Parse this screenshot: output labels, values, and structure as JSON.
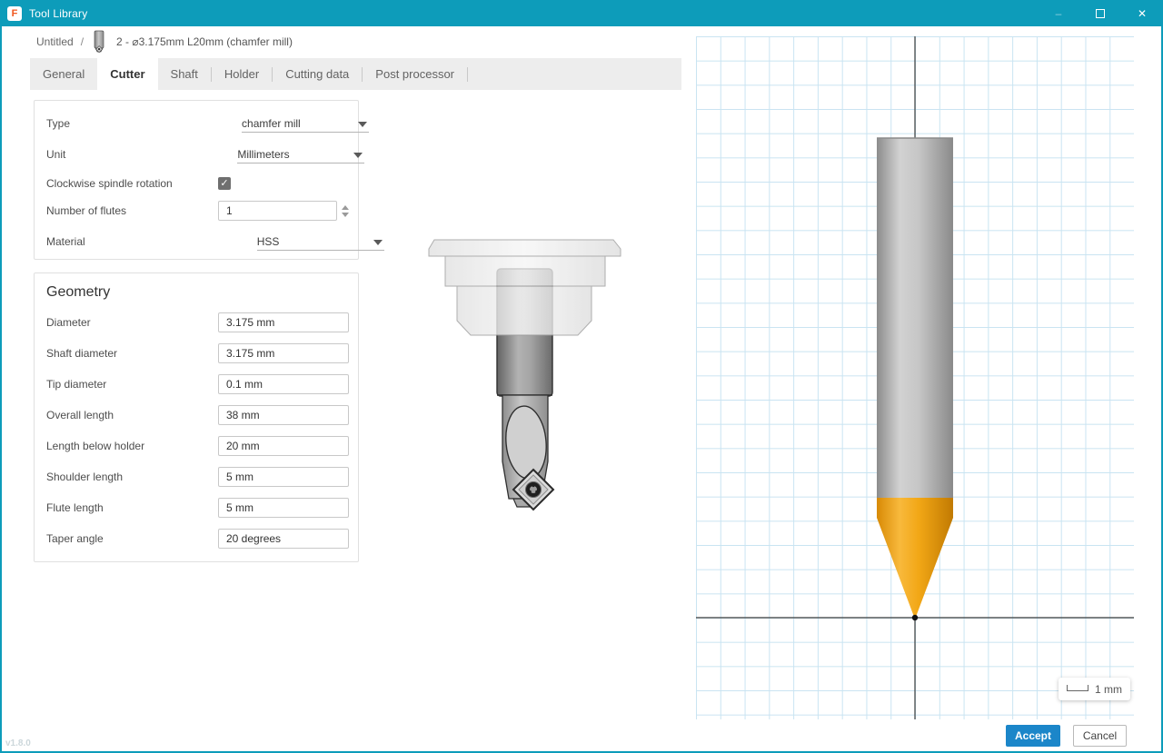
{
  "titlebar": {
    "title": "Tool Library",
    "controls": {
      "minimize": "–",
      "close": "✕"
    }
  },
  "breadcrumb": {
    "root": "Untitled",
    "separator": "/",
    "current": "2 - ⌀3.175mm L20mm (chamfer mill)"
  },
  "tabs": [
    {
      "label": "General",
      "active": false
    },
    {
      "label": "Cutter",
      "active": true
    },
    {
      "label": "Shaft",
      "active": false
    },
    {
      "label": "Holder",
      "active": false
    },
    {
      "label": "Cutting data",
      "active": false
    },
    {
      "label": "Post processor",
      "active": false
    }
  ],
  "cutter": {
    "type": {
      "label": "Type",
      "value": "chamfer mill"
    },
    "unit": {
      "label": "Unit",
      "value": "Millimeters"
    },
    "clockwise": {
      "label": "Clockwise spindle rotation",
      "checked": true
    },
    "flutes": {
      "label": "Number of flutes",
      "value": "1"
    },
    "material": {
      "label": "Material",
      "value": "HSS"
    }
  },
  "geometry": {
    "title": "Geometry",
    "fields": [
      {
        "label": "Diameter",
        "value": "3.175 mm"
      },
      {
        "label": "Shaft diameter",
        "value": "3.175 mm"
      },
      {
        "label": "Tip diameter",
        "value": "0.1 mm"
      },
      {
        "label": "Overall length",
        "value": "38 mm"
      },
      {
        "label": "Length below holder",
        "value": "20 mm"
      },
      {
        "label": "Shoulder length",
        "value": "5 mm"
      },
      {
        "label": "Flute length",
        "value": "5 mm"
      },
      {
        "label": "Taper angle",
        "value": "20 degrees"
      }
    ]
  },
  "viewport": {
    "scale_label": "1 mm"
  },
  "footer": {
    "accept": "Accept",
    "cancel": "Cancel",
    "version": "v1.8.0"
  },
  "icons": {
    "check": "✓",
    "fusion_logo": "F"
  },
  "colors": {
    "titlebar_teal": "#0d9cba",
    "accent_blue": "#1b86c9",
    "grid_line": "#c9e4f2",
    "tool_gray": "#ababab",
    "tool_orange": "#f0a11c"
  }
}
